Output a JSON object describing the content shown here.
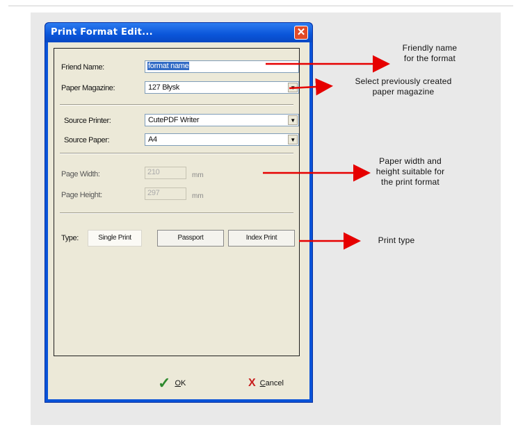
{
  "dialog": {
    "title": "Print Format Edit...",
    "close_symbol": "✕",
    "fields": {
      "friendly_name_label": "Friend Name:",
      "friendly_name_value": "format name",
      "paper_magazine_label": "Paper Magazine:",
      "paper_magazine_value": "127 Błysk",
      "source_printer_label": "Source Printer:",
      "source_printer_value": "CutePDF Writer",
      "source_paper_label": "Source Paper:",
      "source_paper_value": "A4",
      "page_width_label": "Page Width:",
      "page_width_value": "210",
      "page_height_label": "Page Height:",
      "page_height_value": "297",
      "unit": "mm"
    },
    "type": {
      "label": "Type:",
      "options": [
        "Single Print",
        "Passport",
        "Index Print"
      ],
      "selected": "Single Print"
    },
    "buttons": {
      "ok_label": "OK",
      "ok_accel": "O",
      "ok_rest": "K",
      "cancel_accel": "C",
      "cancel_rest": "ancel"
    },
    "icons": {
      "ok": "check-icon",
      "cancel": "x-icon",
      "dropdown": "chevron-down-icon"
    }
  },
  "annotations": [
    {
      "text_line1": "Friendly name",
      "text_line2": "for the format"
    },
    {
      "text_line1": "Select previously created",
      "text_line2": "paper magazine"
    },
    {
      "text_line1": "Paper width and",
      "text_line2": "height suitable for",
      "text_line3": "the print format"
    },
    {
      "text_line1": "Print type"
    }
  ],
  "colors": {
    "titlebar": "#0a55d9",
    "arrow": "#e60000",
    "client": "#ece9d8"
  }
}
